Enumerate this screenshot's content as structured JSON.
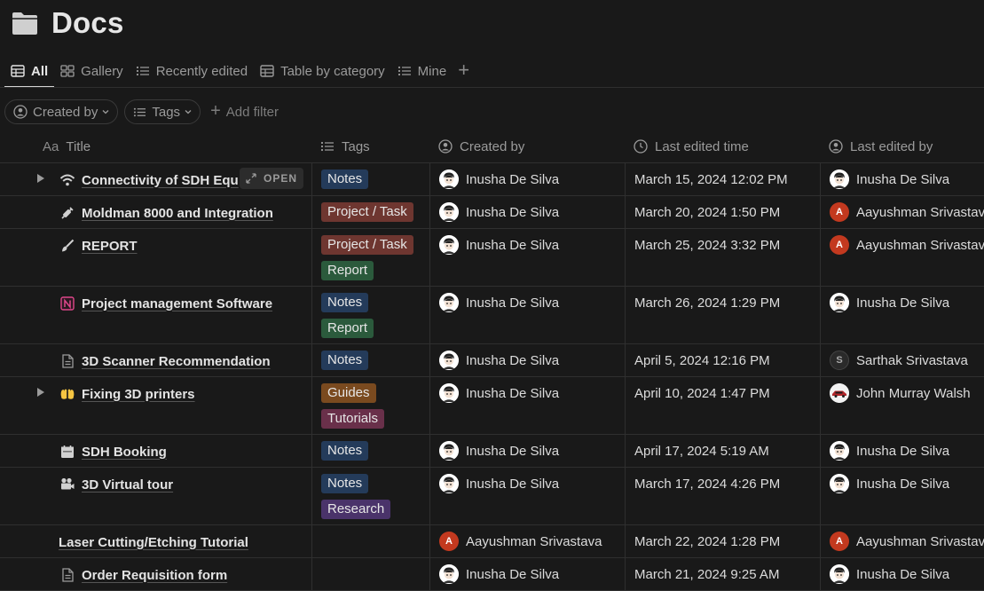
{
  "page": {
    "title": "Docs",
    "icon": "folder-icon"
  },
  "tabs": [
    {
      "label": "All",
      "icon": "table-icon",
      "active": true
    },
    {
      "label": "Gallery",
      "icon": "gallery-icon"
    },
    {
      "label": "Recently edited",
      "icon": "list-icon"
    },
    {
      "label": "Table by category",
      "icon": "table-icon"
    },
    {
      "label": "Mine",
      "icon": "list-icon"
    }
  ],
  "filters": {
    "created_by": "Created by",
    "tags": "Tags",
    "add_filter": "Add filter"
  },
  "columns": {
    "title": "Title",
    "title_icon": "Aa",
    "tags": "Tags",
    "created_by": "Created by",
    "last_edited_time": "Last edited time",
    "last_edited_by": "Last edited by"
  },
  "open_label": "OPEN",
  "rows": [
    {
      "title": "Connectivity of SDH Equ",
      "icon": "wifi-icon",
      "expandable": true,
      "tags": [
        "Notes"
      ],
      "created_by": "Inusha De Silva",
      "created_avatar": "face",
      "time": "March 15, 2024 12:02 PM",
      "editor": "Inusha De Silva",
      "editor_avatar": "face"
    },
    {
      "title": "Moldman 8000 and Integration",
      "icon": "syringe-icon",
      "tags": [
        "Project / Task"
      ],
      "created_by": "Inusha De Silva",
      "created_avatar": "face",
      "time": "March 20, 2024 1:50 PM",
      "editor": "Aayushman Srivastava",
      "editor_avatar": "A"
    },
    {
      "title": "REPORT",
      "icon": "brush-icon",
      "tags": [
        "Project / Task",
        "Report"
      ],
      "created_by": "Inusha De Silva",
      "created_avatar": "face",
      "time": "March 25, 2024 3:32 PM",
      "editor": "Aayushman Srivastava",
      "editor_avatar": "A"
    },
    {
      "title": "Project management Software",
      "icon": "notion-icon",
      "tags": [
        "Notes",
        "Report"
      ],
      "created_by": "Inusha De Silva",
      "created_avatar": "face",
      "time": "March 26, 2024 1:29 PM",
      "editor": "Inusha De Silva",
      "editor_avatar": "face"
    },
    {
      "title": "3D Scanner Recommendation",
      "icon": "document-icon",
      "tags": [
        "Notes"
      ],
      "created_by": "Inusha De Silva",
      "created_avatar": "face",
      "time": "April 5, 2024 12:16 PM",
      "editor": "Sarthak Srivastava",
      "editor_avatar": "S"
    },
    {
      "title": "Fixing 3D printers",
      "icon": "raised-hands-icon",
      "expandable": true,
      "tags": [
        "Guides",
        "Tutorials"
      ],
      "created_by": "Inusha De Silva",
      "created_avatar": "face",
      "time": "April 10, 2024 1:47 PM",
      "editor": "John Murray Walsh",
      "editor_avatar": "car"
    },
    {
      "title": "SDH Booking",
      "icon": "calendar-icon",
      "tags": [
        "Notes"
      ],
      "created_by": "Inusha De Silva",
      "created_avatar": "face",
      "time": "April 17, 2024 5:19 AM",
      "editor": "Inusha De Silva",
      "editor_avatar": "face"
    },
    {
      "title": "3D Virtual tour",
      "icon": "video-camera-icon",
      "tags": [
        "Notes",
        "Research"
      ],
      "created_by": "Inusha De Silva",
      "created_avatar": "face",
      "time": "March 17, 2024 4:26 PM",
      "editor": "Inusha De Silva",
      "editor_avatar": "face"
    },
    {
      "title": "Laser Cutting/Etching Tutorial",
      "icon": "",
      "tags": [],
      "created_by": "Aayushman Srivastava",
      "created_avatar": "A",
      "time": "March 22, 2024 1:28 PM",
      "editor": "Aayushman Srivastava",
      "editor_avatar": "A"
    },
    {
      "title": "Order Requisition form",
      "icon": "document-icon",
      "tags": [],
      "created_by": "Inusha De Silva",
      "created_avatar": "face",
      "time": "March 21, 2024 9:25 AM",
      "editor": "Inusha De Silva",
      "editor_avatar": "face"
    }
  ],
  "tag_colors": {
    "Notes": "#243b5a",
    "Project / Task": "#6e3630",
    "Report": "#2b5a3c",
    "Guides": "#7a4a1f",
    "Tutorials": "#69304a",
    "Research": "#4a336a"
  }
}
